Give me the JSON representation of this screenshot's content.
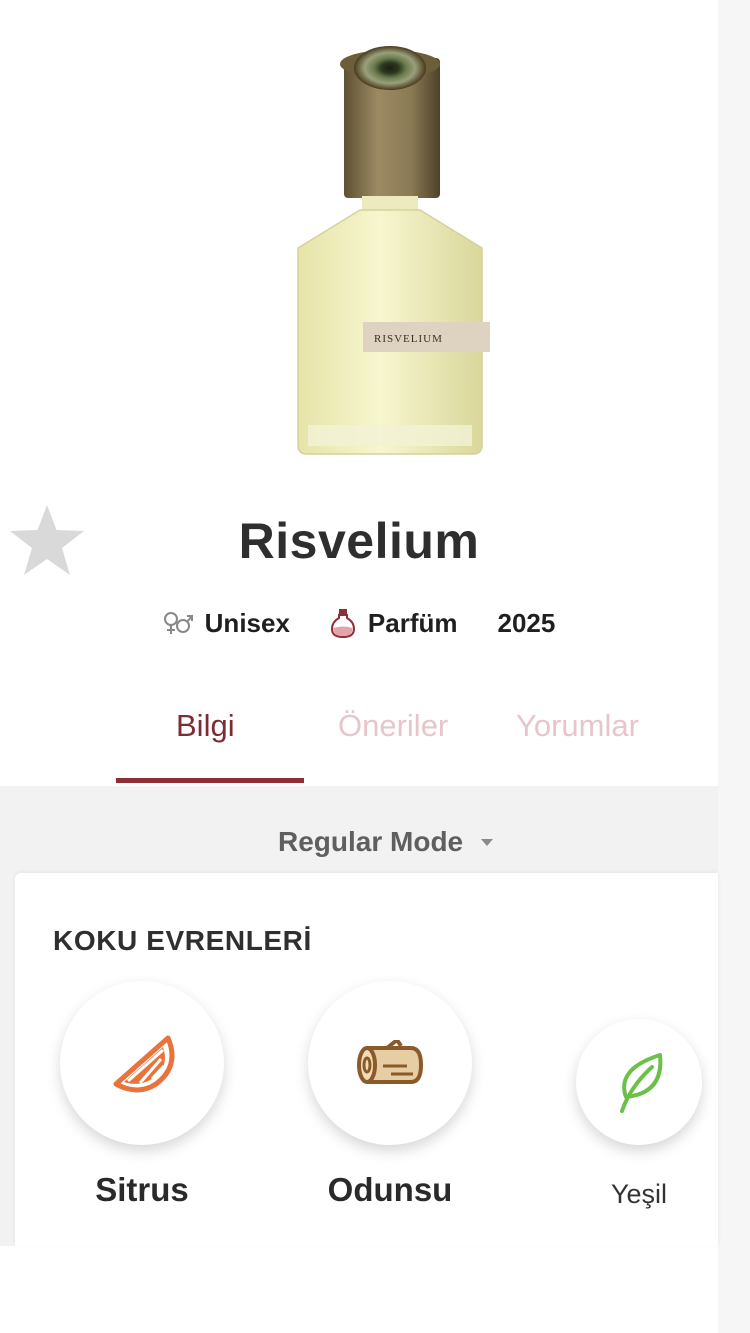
{
  "product": {
    "name": "Risvelium",
    "bottle_label": "RISVELIUM",
    "gender": "Unisex",
    "type": "Parfüm",
    "year": "2025"
  },
  "tabs": [
    {
      "label": "Bilgi",
      "active": true
    },
    {
      "label": "Öneriler",
      "active": false
    },
    {
      "label": "Yorumlar",
      "active": false
    }
  ],
  "mode_selector": {
    "value": "Regular Mode"
  },
  "scent_universes": {
    "title": "KOKU EVRENLERİ",
    "families": [
      {
        "label": "Sitrus",
        "icon": "orange-slice-icon",
        "color": "#e8743b"
      },
      {
        "label": "Odunsu",
        "icon": "log-icon",
        "color": "#8a5a2b"
      },
      {
        "label": "Yeşil",
        "icon": "leaf-icon",
        "color": "#6cc04a"
      }
    ]
  },
  "colors": {
    "accent": "#8e2f36",
    "tab_inactive": "#e6c6cb",
    "favorite_star": "#d8d8d8"
  }
}
